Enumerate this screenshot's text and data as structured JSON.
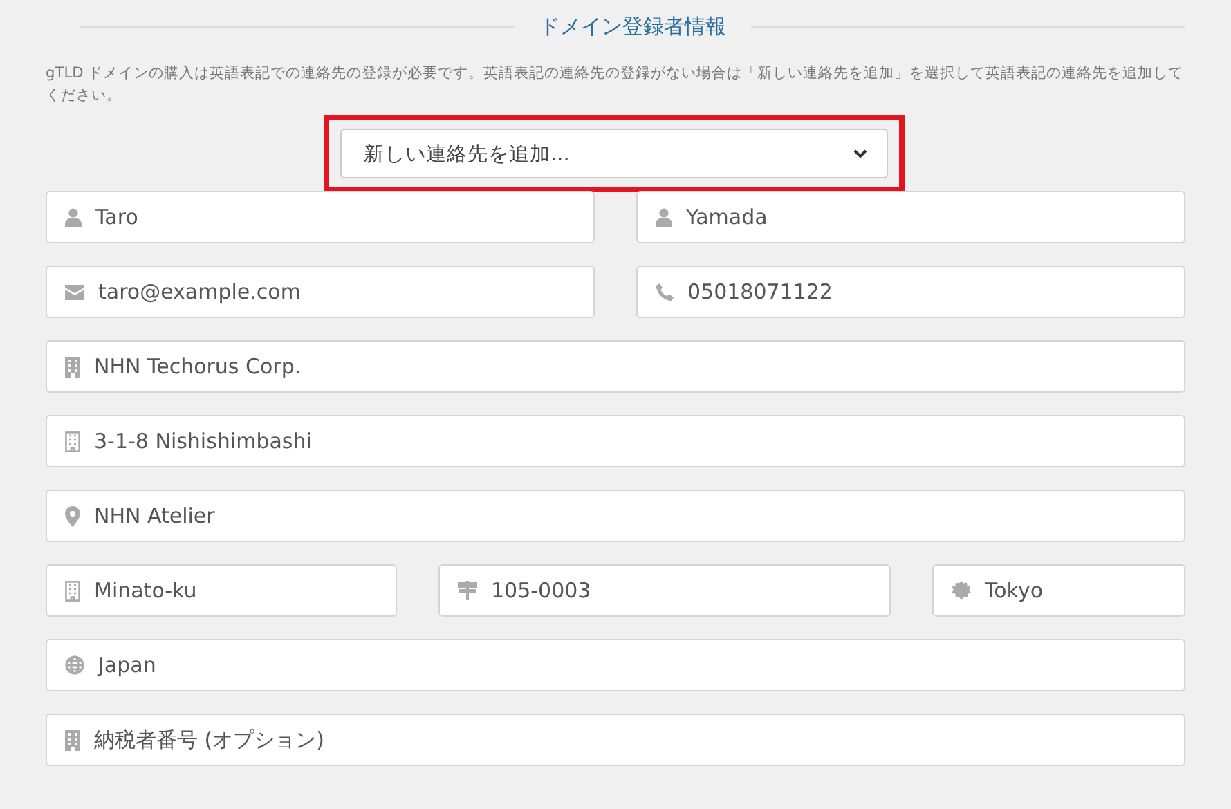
{
  "section_title": "ドメイン登録者情報",
  "intro": "gTLD ドメインの購入は英語表記での連絡先の登録が必要です。英語表記の連絡先の登録がない場合は「新しい連絡先を追加」を選択して英語表記の連絡先を追加してください。",
  "contact_select": {
    "value": "新しい連絡先を追加...",
    "highlighted": true
  },
  "rows": [
    {
      "fields": [
        {
          "kind": "first_name",
          "value": "Taro"
        },
        {
          "kind": "last_name",
          "value": "Yamada"
        }
      ]
    },
    {
      "fields": [
        {
          "kind": "email",
          "value": "taro@example.com"
        },
        {
          "kind": "phone",
          "value": "05018071122"
        }
      ]
    },
    {
      "fields": [
        {
          "kind": "organization",
          "value": "NHN Techorus Corp."
        }
      ]
    },
    {
      "fields": [
        {
          "kind": "address",
          "value": "3-1-8 Nishishimbashi"
        }
      ]
    },
    {
      "fields": [
        {
          "kind": "address2",
          "value": "NHN Atelier"
        }
      ]
    },
    {
      "fields": [
        {
          "kind": "city",
          "value": "Minato-ku"
        },
        {
          "kind": "postal_code",
          "value": "105-0003"
        },
        {
          "kind": "state",
          "value": "Tokyo"
        }
      ]
    },
    {
      "fields": [
        {
          "kind": "country",
          "value": "Japan"
        }
      ]
    },
    {
      "fields": [
        {
          "kind": "tax_id",
          "value": "納税者番号 (オプション)"
        }
      ]
    }
  ]
}
